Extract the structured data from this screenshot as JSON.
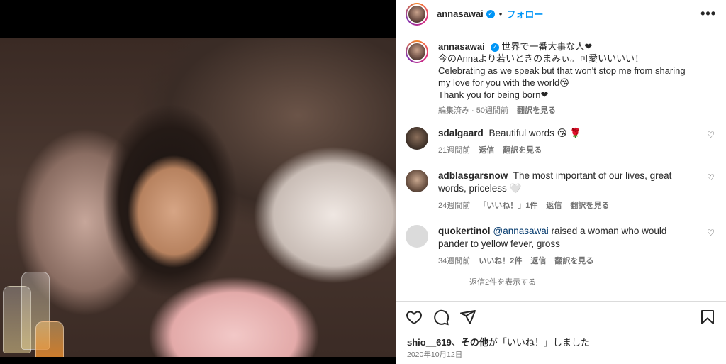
{
  "post": {
    "username": "annasawai",
    "follow_label": "フォロー",
    "more_label": "•••"
  },
  "caption": {
    "username": "annasawai",
    "lines": [
      "世界で一番大事な人❤",
      "今のAnnaより若いときのまみぃ。可愛いいいい！",
      "Celebrating as we speak but that won't stop me from sharing my love for you with the world😘",
      "Thank you for being born❤"
    ],
    "edited": "編集済み · 50週間前",
    "translate": "翻訳を見る"
  },
  "comments": [
    {
      "username": "sdalgaard",
      "text": "Beautiful words 😘 🌹",
      "time": "21週間前",
      "likes": "",
      "reply": "返信",
      "translate": "翻訳を見る"
    },
    {
      "username": "adblasgarsnow",
      "text": "The most important of our lives, great words, priceless 🤍",
      "time": "24週間前",
      "likes": "「いいね！」1件",
      "reply": "返信",
      "translate": "翻訳を見る"
    },
    {
      "username": "quokertinol",
      "mention": "@annasawai",
      "text": " raised a woman who would pander to yellow fever, gross",
      "time": "34週間前",
      "likes": "いいね！2件",
      "reply": "返信",
      "translate": "翻訳を見る"
    }
  ],
  "view_replies": "返信2件を表示する",
  "likes_bar": {
    "user": "shio__619",
    "sep": "、",
    "others": "その他",
    "suffix": "が「いいね！」しました"
  },
  "date": "2020年10月12日",
  "colors": {
    "accent": "#0095f6",
    "text": "#262626",
    "muted": "#737373",
    "border": "#dbdbdb"
  },
  "icons": [
    "heart-icon",
    "comment-icon",
    "share-icon",
    "bookmark-icon",
    "verified-icon",
    "more-icon"
  ]
}
